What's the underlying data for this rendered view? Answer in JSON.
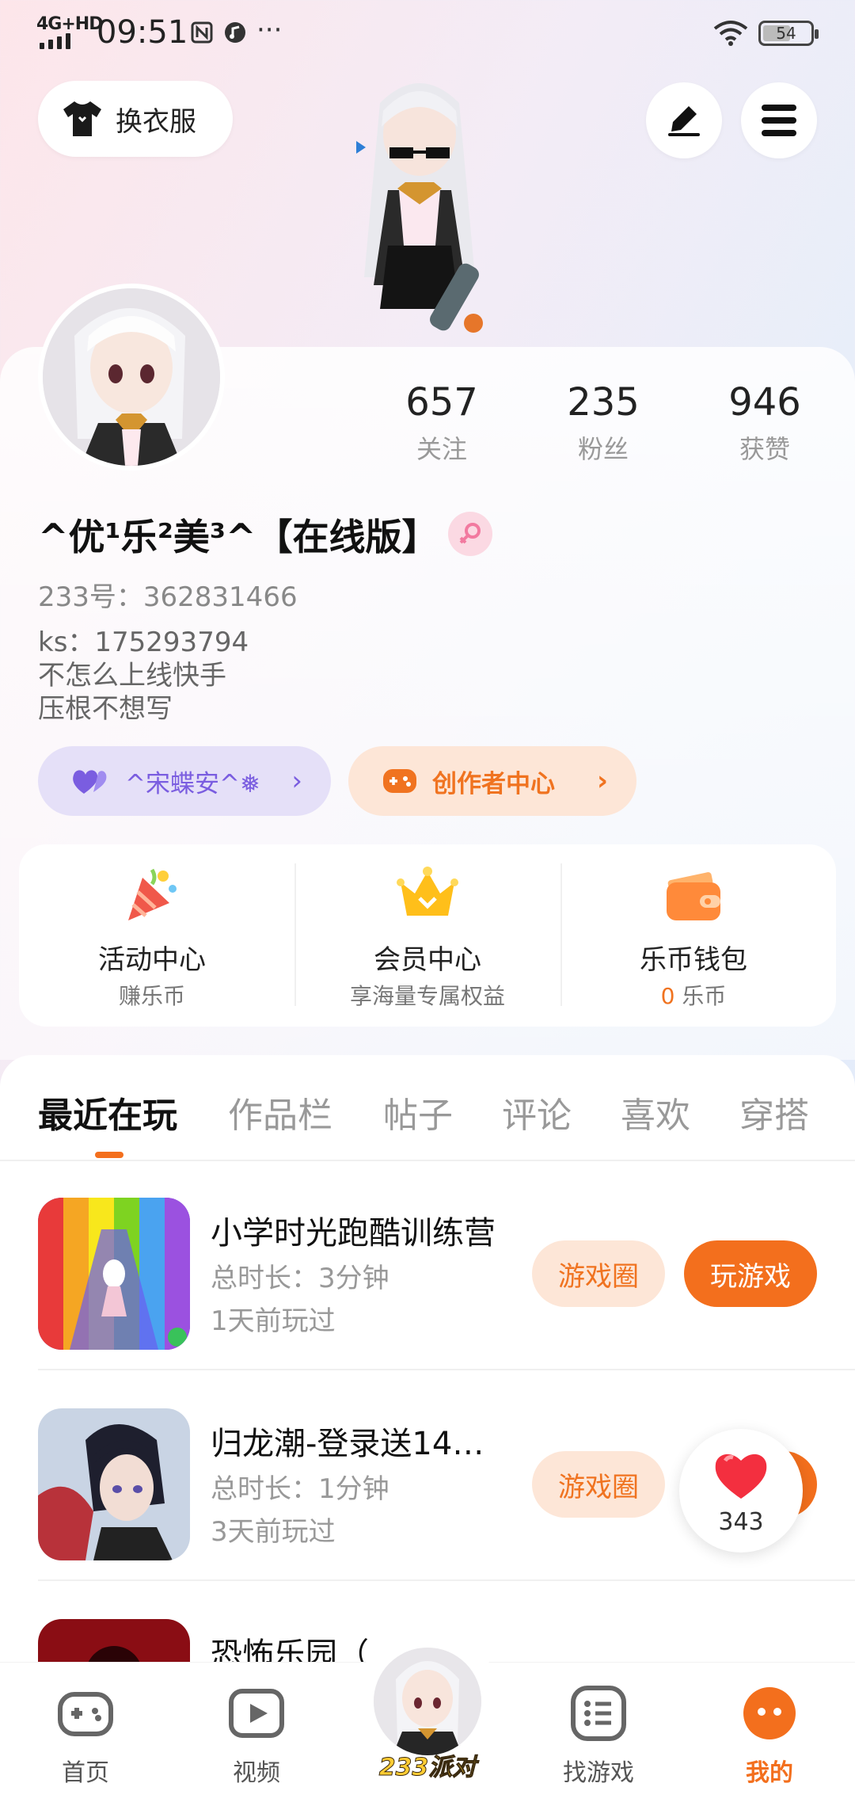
{
  "status_bar": {
    "network": "4G+HD",
    "time": "09:51",
    "icons": [
      "nfc-icon",
      "music-icon",
      "more-dots-icon",
      "wifi-icon"
    ],
    "more": "···",
    "battery": "54"
  },
  "header": {
    "dress_label": "换衣服",
    "icons": [
      "edit-icon",
      "menu-icon"
    ]
  },
  "profile": {
    "stats": [
      {
        "num": "657",
        "label": "关注"
      },
      {
        "num": "235",
        "label": "粉丝"
      },
      {
        "num": "946",
        "label": "获赞"
      }
    ],
    "username": "^优¹乐²美³^【在线版】",
    "gender": "female",
    "uid": "233号：362831466",
    "bio": [
      "ks：175293794",
      "不怎么上线快手",
      "压根不想写"
    ],
    "fan_pill": "^宋蝶安^❅",
    "creator_pill": "创作者中心",
    "chevron": "›"
  },
  "features": [
    {
      "title": "活动中心",
      "sub": "赚乐币",
      "icon": "party-popper-icon"
    },
    {
      "title": "会员中心",
      "sub": "享海量专属权益",
      "icon": "crown-icon"
    },
    {
      "title": "乐币钱包",
      "sub_num": "0",
      "sub_unit": "乐币",
      "icon": "wallet-icon"
    }
  ],
  "tabs": [
    "最近在玩",
    "作品栏",
    "帖子",
    "评论",
    "喜欢",
    "穿搭"
  ],
  "games": [
    {
      "name": "小学时光跑酷训练营",
      "duration": "总时长：3分钟",
      "last": "1天前玩过",
      "circle": "游戏圈",
      "play": "玩游戏"
    },
    {
      "name": "归龙潮-登录送14…",
      "duration": "总时长：1分钟",
      "last": "3天前玩过",
      "circle": "游戏圈"
    },
    {
      "name": "恐怖乐园（"
    }
  ],
  "like_count": "343",
  "bottom_nav": [
    {
      "label": "首页",
      "icon": "gamepad-icon"
    },
    {
      "label": "视频",
      "icon": "video-icon"
    },
    {
      "label": "233派对",
      "icon": "party-avatar"
    },
    {
      "label": "找游戏",
      "icon": "game-list-icon"
    },
    {
      "label": "我的",
      "icon": "me-icon",
      "active": true
    }
  ],
  "colors": {
    "accent": "#f36f1d",
    "accent_light": "#fde6d7",
    "purple": "#7a5de0"
  }
}
